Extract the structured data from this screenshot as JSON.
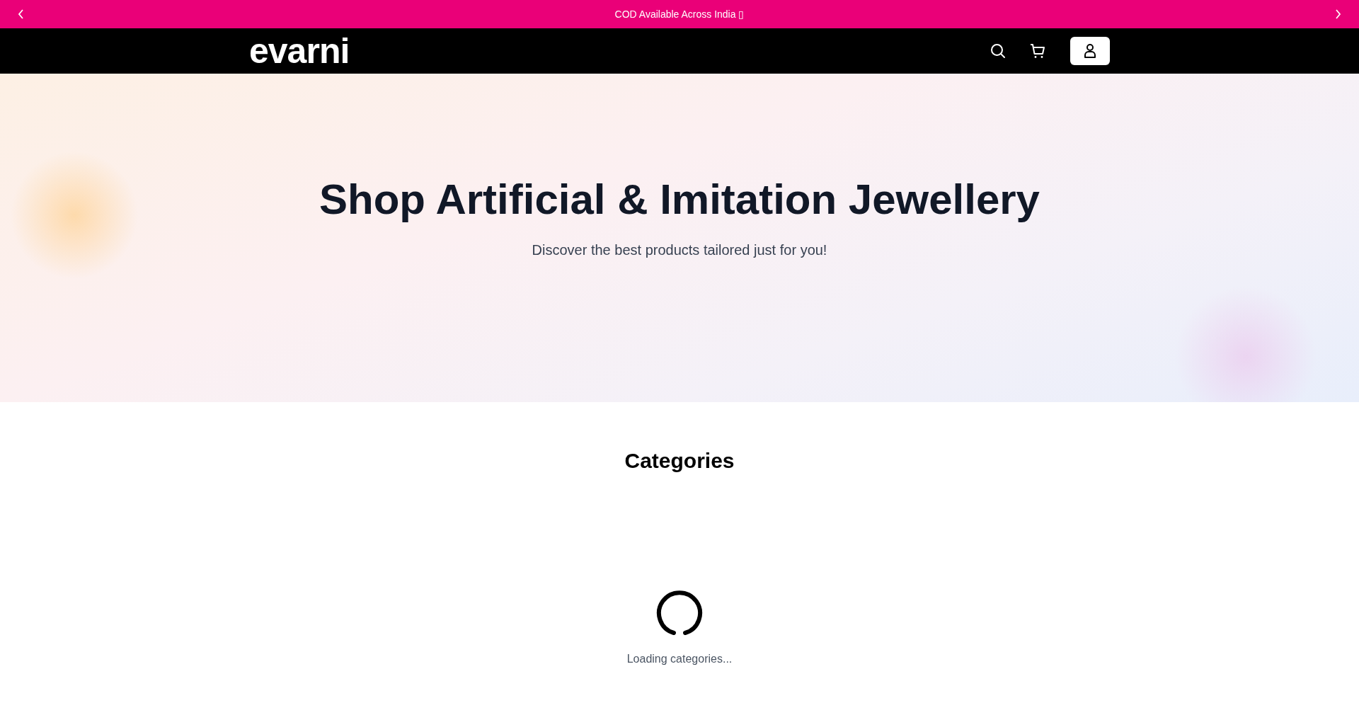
{
  "announcement": {
    "text": "COD Available Across India",
    "glyph": "▯"
  },
  "header": {
    "logo": "evarni"
  },
  "hero": {
    "title": "Shop Artificial & Imitation Jewellery",
    "subtitle": "Discover the best products tailored just for you!"
  },
  "categories": {
    "heading": "Categories",
    "loading_text": "Loading categories..."
  }
}
